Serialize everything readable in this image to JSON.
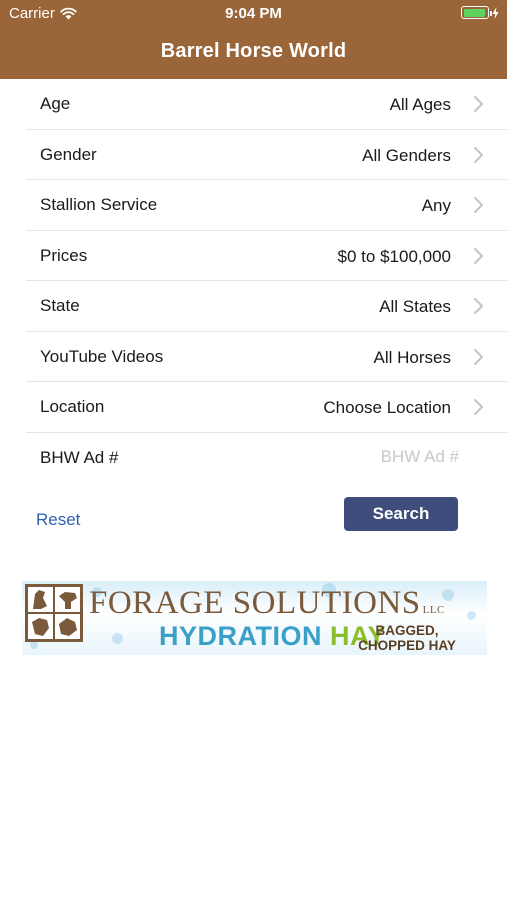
{
  "status_bar": {
    "carrier": "Carrier",
    "time": "9:04 PM",
    "battery_level": 0.92,
    "battery_color": "#5fd35f"
  },
  "nav": {
    "title": "Barrel Horse World",
    "bar_color": "#9a6539"
  },
  "filters": [
    {
      "label": "Age",
      "value": "All Ages"
    },
    {
      "label": "Gender",
      "value": "All Genders"
    },
    {
      "label": "Stallion Service",
      "value": "Any"
    },
    {
      "label": "Prices",
      "value": "$0 to $100,000"
    },
    {
      "label": "State",
      "value": "All States"
    },
    {
      "label": "YouTube Videos",
      "value": "All Horses"
    },
    {
      "label": "Location",
      "value": "Choose Location"
    }
  ],
  "ad_number": {
    "label": "BHW Ad #",
    "placeholder": "BHW Ad #",
    "value": ""
  },
  "actions": {
    "reset_label": "Reset",
    "search_label": "Search",
    "search_color": "#3f4d7d",
    "reset_color": "#2f5fb3"
  },
  "banner": {
    "title": "FORAGE SOLUTIONS",
    "llc": "LLC",
    "hydration": "HYDRATION",
    "hay": "HAY",
    "bagged": "BAGGED,",
    "chopped": "CHOPPED HAY"
  }
}
